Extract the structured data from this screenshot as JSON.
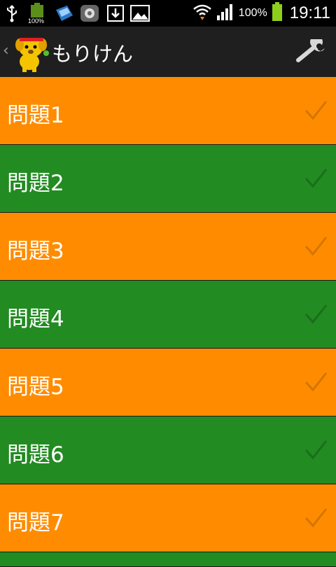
{
  "status_bar": {
    "battery_percent_text": "100%",
    "battery_level": 1.0,
    "time": "19:11",
    "icons": [
      "usb-icon",
      "battery-widget-icon",
      "sd-card-icon",
      "app-notification-icon",
      "download-icon",
      "gallery-icon",
      "wifi-icon",
      "signal-icon",
      "battery-icon"
    ]
  },
  "action_bar": {
    "title": "もりけん",
    "icons": [
      "back-chevron-icon",
      "dog-mascot-logo",
      "wrench-icon"
    ]
  },
  "questions": [
    {
      "label": "問題1",
      "color": "#ff8c00"
    },
    {
      "label": "問題2",
      "color": "#228b22"
    },
    {
      "label": "問題3",
      "color": "#ff8c00"
    },
    {
      "label": "問題4",
      "color": "#228b22"
    },
    {
      "label": "問題5",
      "color": "#ff8c00"
    },
    {
      "label": "問題6",
      "color": "#228b22"
    },
    {
      "label": "問題7",
      "color": "#ff8c00"
    }
  ],
  "colors": {
    "orange": "#ff8c00",
    "green": "#228b22",
    "action_bar": "#1f1f1f"
  }
}
